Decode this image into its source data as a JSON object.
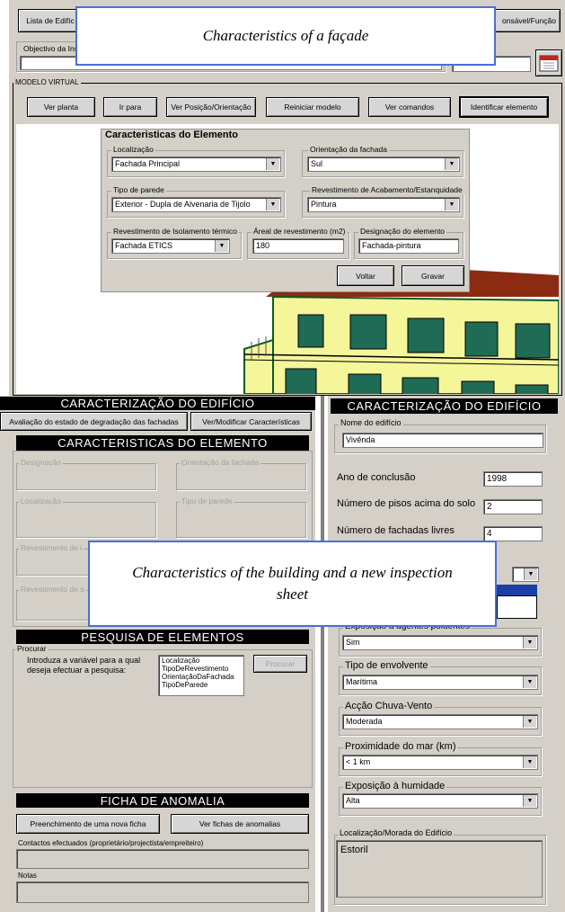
{
  "top": {
    "buttons": {
      "lista_edificios": "Lista de Edifíc",
      "responsavel": "onsável/Função"
    },
    "objective_label": "Objectivo da Ins",
    "callout": "Characteristics of a façade"
  },
  "modelo": {
    "title": "MODELO VIRTUAL",
    "toolbar": [
      "Ver planta",
      "Ir para",
      "Ver Posição/Orientação",
      "Reiniciar modelo",
      "Ver comandos",
      "Identificar elemento"
    ]
  },
  "element_panel": {
    "title": "Caracteristicas do Elemento",
    "localizacao": {
      "label": "Localização",
      "value": "Fachada Principal"
    },
    "orientacao": {
      "label": "Orientação da fachada",
      "value": "Sul"
    },
    "tipo_parede": {
      "label": "Tipo de parede",
      "value": "Exterior - Dupla de Alvenaria de Tijolo"
    },
    "revestimento_acab": {
      "label": "Revestimento de Acabamento/Estanquidade",
      "value": "Pintura"
    },
    "revestimento_isol": {
      "label": "Revestimento de Isolamento térmico",
      "value": "Fachada ETICS"
    },
    "area": {
      "label": "Áreal de revestimento (m2)",
      "value": "180"
    },
    "designacao": {
      "label": "Designação do elemento",
      "value": "Fachada-pintura"
    },
    "buttons": {
      "voltar": "Voltar",
      "gravar": "Gravar"
    }
  },
  "left": {
    "bar_edificio": "CARACTERIZAÇÃO DO EDIFÍCIO",
    "btn_avaliacao": "Avaliação do estado de degradação das fachadas",
    "btn_ver_modificar": "Ver/Modificar Características",
    "bar_elemento": "CARACTERISTICAS DO ELEMENTO",
    "groups": {
      "designacao": "Designação",
      "orientacao": "Orientação da fachada",
      "localizacao": "Localização",
      "tipo_parede": "Tipo de parede",
      "revestimento1": "Revestimento de i",
      "revestimento2": "Revestimento de a"
    },
    "bar_pesquisa": "PESQUISA DE ELEMENTOS",
    "procurar_label": "Procurar",
    "pesquisa_text": "Introduza a variável para a qual deseja efectuar a pesquisa:",
    "pesquisa_options": [
      "Localização",
      "TipoDeRevestimento",
      "OrientaçãoDaFachada",
      "TipoDeParede"
    ],
    "btn_procurar": "Procurar",
    "bar_anomalia": "FICHA DE ANOMALIA",
    "btn_preenchimento": "Preenchimento de uma nova ficha",
    "btn_ver_fichas": "Ver fichas de anomalias",
    "contactos_label": "Contactos efectuados (proprietário/projectista/empreiteiro)",
    "notas_label": "Notas"
  },
  "right": {
    "bar": "CARACTERIZAÇÃO DO EDIFÍCIO",
    "nome": {
      "label": "Nome do edifício",
      "value": "Vivênda"
    },
    "ano": {
      "label": "Ano de conclusão",
      "value": "1998"
    },
    "pisos": {
      "label": "Número de pisos acima do solo",
      "value": "2"
    },
    "fachadas": {
      "label": "Número de fachadas livres",
      "value": "4"
    },
    "exposicao_poluentes": {
      "label": "Exposição a agentes poluentes",
      "value": "Sim"
    },
    "envolvente": {
      "label": "Tipo de envolvente",
      "value": "Marítima"
    },
    "chuva": {
      "label": "Acção Chuva-Vento",
      "value": "Moderada"
    },
    "mar": {
      "label": "Proximidade do mar (km)",
      "value": "< 1 km"
    },
    "humidade": {
      "label": "Exposição à humidade",
      "value": "Alta"
    },
    "morada": {
      "label": "Localização/Morada do Edifício",
      "value": "Estoril"
    }
  },
  "bottom_callout": "Characteristics of the building and a new inspection sheet",
  "colors": {
    "window_bg": "#d4d0c8",
    "bar_bg": "#000000",
    "callout_border": "#4a6fd4",
    "wall_yellow": "#f5f59a",
    "roof_brown": "#8b2b12",
    "window_green": "#1f6b55"
  }
}
